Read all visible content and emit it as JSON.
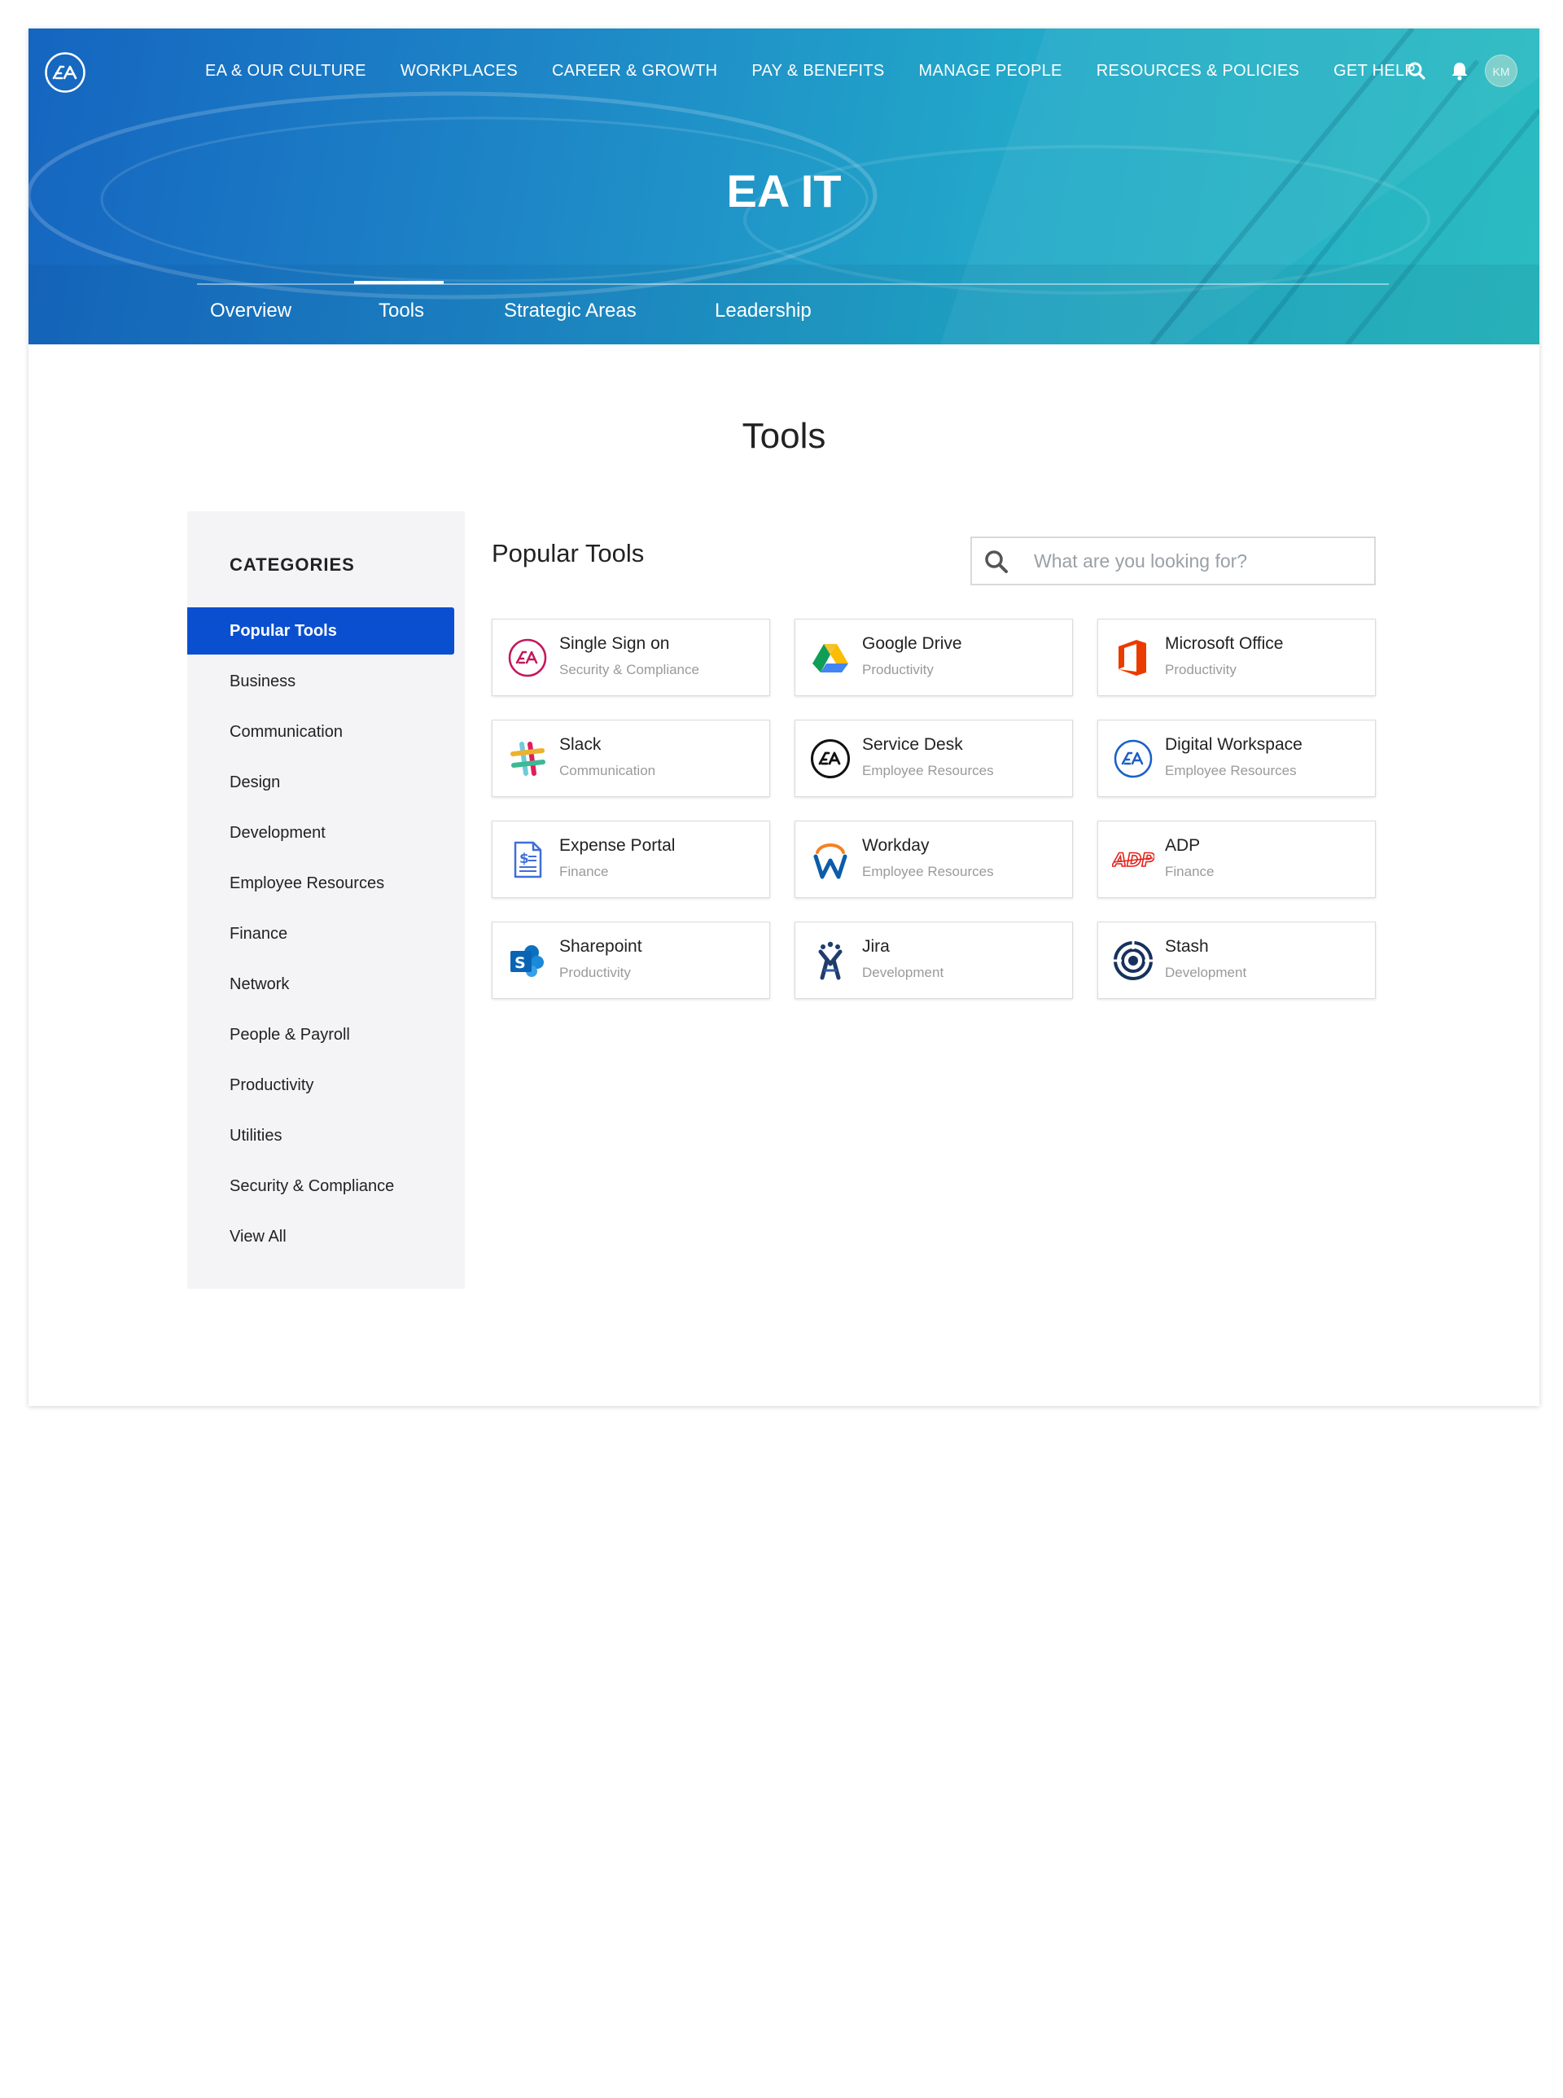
{
  "header": {
    "nav": [
      "EA & OUR CULTURE",
      "WORKPLACES",
      "CAREER & GROWTH",
      "PAY & BENEFITS",
      "MANAGE PEOPLE",
      "RESOURCES & POLICIES",
      "GET HELP"
    ],
    "avatar_initials": "KM",
    "hero_title": "EA IT",
    "subnav": [
      "Overview",
      "Tools",
      "Strategic Areas",
      "Leadership"
    ],
    "active_subnav": "Tools"
  },
  "page": {
    "title": "Tools"
  },
  "sidebar": {
    "heading": "CATEGORIES",
    "items": [
      "Popular Tools",
      "Business",
      "Communication",
      "Design",
      "Development",
      "Employee Resources",
      "Finance",
      "Network",
      "People & Payroll",
      "Productivity",
      "Utilities",
      "Security & Compliance",
      "View All"
    ],
    "active": "Popular Tools"
  },
  "main": {
    "section_title": "Popular Tools",
    "search": {
      "placeholder": "What are you looking for?",
      "value": ""
    },
    "tools": [
      {
        "name": "Single Sign on",
        "category": "Security & Compliance",
        "icon": "ea-sso-icon"
      },
      {
        "name": "Google Drive",
        "category": "Productivity",
        "icon": "google-drive-icon"
      },
      {
        "name": "Microsoft Office",
        "category": "Productivity",
        "icon": "microsoft-office-icon"
      },
      {
        "name": "Slack",
        "category": "Communication",
        "icon": "slack-icon"
      },
      {
        "name": "Service Desk",
        "category": "Employee Resources",
        "icon": "ea-service-desk-icon"
      },
      {
        "name": "Digital Workspace",
        "category": "Employee Resources",
        "icon": "ea-digital-workspace-icon"
      },
      {
        "name": "Expense Portal",
        "category": "Finance",
        "icon": "expense-document-icon"
      },
      {
        "name": "Workday",
        "category": "Employee Resources",
        "icon": "workday-icon"
      },
      {
        "name": "ADP",
        "category": "Finance",
        "icon": "adp-icon"
      },
      {
        "name": "Sharepoint",
        "category": "Productivity",
        "icon": "sharepoint-icon"
      },
      {
        "name": "Jira",
        "category": "Development",
        "icon": "jira-icon"
      },
      {
        "name": "Stash",
        "category": "Development",
        "icon": "stash-icon"
      }
    ]
  },
  "colors": {
    "hero_gradient_start": "#1565c0",
    "hero_gradient_end": "#2bbcc0",
    "accent_blue": "#0a4fd0",
    "sidebar_bg": "#f4f4f6"
  }
}
